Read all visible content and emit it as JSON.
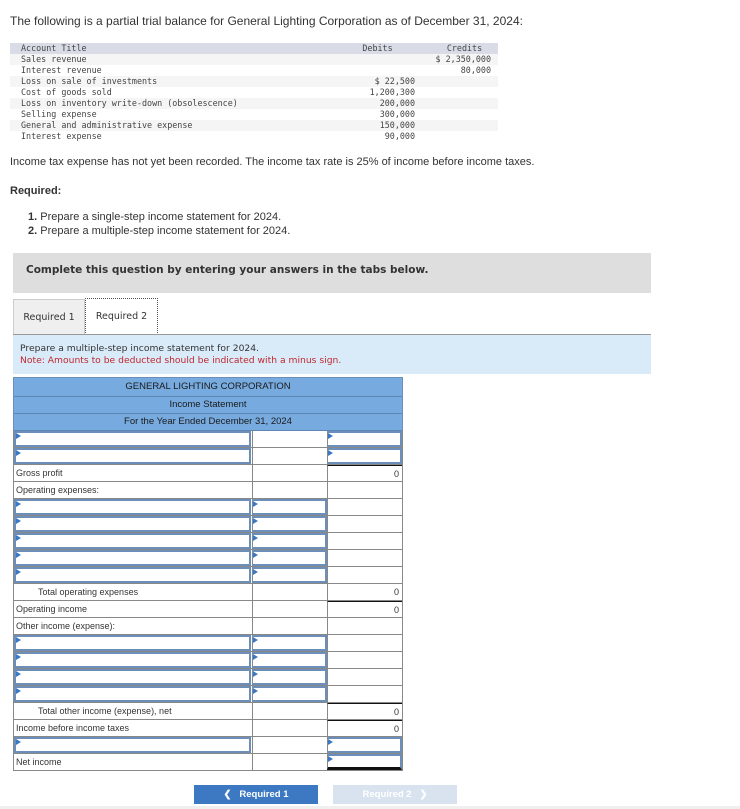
{
  "intro": "The following is a partial trial balance for General Lighting Corporation as of December 31, 2024:",
  "trial_balance": {
    "headers": [
      "Account Title",
      "Debits",
      "Credits"
    ],
    "rows": [
      {
        "account": "Sales revenue",
        "debit": "",
        "credit": "$ 2,350,000"
      },
      {
        "account": "Interest revenue",
        "debit": "",
        "credit": "80,000"
      },
      {
        "account": "Loss on sale of investments",
        "debit": "$ 22,500",
        "credit": ""
      },
      {
        "account": "Cost of goods sold",
        "debit": "1,200,300",
        "credit": ""
      },
      {
        "account": "Loss on inventory write-down (obsolescence)",
        "debit": "200,000",
        "credit": ""
      },
      {
        "account": "Selling expense",
        "debit": "300,000",
        "credit": ""
      },
      {
        "account": "General and administrative expense",
        "debit": "150,000",
        "credit": ""
      },
      {
        "account": "Interest expense",
        "debit": "90,000",
        "credit": ""
      }
    ]
  },
  "note": "Income tax expense has not yet been recorded. The income tax rate is 25% of income before income taxes.",
  "required": {
    "heading": "Required:",
    "items": [
      {
        "num": "1.",
        "text": "Prepare a single-step income statement for 2024."
      },
      {
        "num": "2.",
        "text": "Prepare a multiple-step income statement for 2024."
      }
    ]
  },
  "banner": "Complete this question by entering your answers in the tabs below.",
  "tabs": [
    {
      "label": "Required 1",
      "active": false
    },
    {
      "label": "Required 2",
      "active": true
    }
  ],
  "instructions": {
    "line1": "Prepare a multiple-step income statement for 2024.",
    "line2": "Note: Amounts to be deducted should be indicated with a minus sign."
  },
  "statement": {
    "company": "GENERAL LIGHTING CORPORATION",
    "title": "Income Statement",
    "period": "For the Year Ended December 31, 2024",
    "gross_profit_label": "Gross profit",
    "gross_profit_value": "0",
    "operating_expenses_label": "Operating expenses:",
    "total_operating_expenses_label": "Total operating expenses",
    "total_operating_expenses_value": "0",
    "operating_income_label": "Operating income",
    "operating_income_value": "0",
    "other_income_label": "Other income (expense):",
    "total_other_label": "Total other income (expense), net",
    "total_other_value": "0",
    "income_before_taxes_label": "Income before income taxes",
    "income_before_taxes_value": "0",
    "net_income_label": "Net income"
  },
  "nav": {
    "prev_label": "Required 1",
    "next_label": "Required 2",
    "prev_icon": "chevron-left",
    "next_icon": "chevron-right"
  }
}
